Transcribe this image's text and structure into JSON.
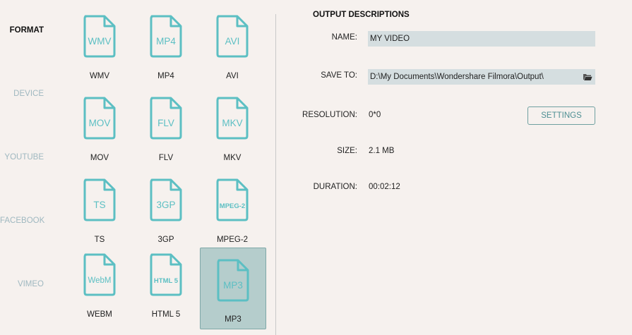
{
  "categories": [
    "FORMAT",
    "DEVICE",
    "YOUTUBE",
    "FACEBOOK",
    "VIMEO"
  ],
  "formats": [
    {
      "icon_text": "WMV",
      "label": "WMV"
    },
    {
      "icon_text": "MP4",
      "label": "MP4"
    },
    {
      "icon_text": "AVI",
      "label": "AVI"
    },
    {
      "icon_text": "MOV",
      "label": "MOV"
    },
    {
      "icon_text": "FLV",
      "label": "FLV"
    },
    {
      "icon_text": "MKV",
      "label": "MKV"
    },
    {
      "icon_text": "TS",
      "label": "TS"
    },
    {
      "icon_text": "3GP",
      "label": "3GP"
    },
    {
      "icon_text": "MPEG-2",
      "label": "MPEG-2"
    },
    {
      "icon_text": "WebM",
      "label": "WEBM"
    },
    {
      "icon_text": "HTML 5",
      "label": "HTML 5"
    },
    {
      "icon_text": "MP3",
      "label": "MP3"
    }
  ],
  "selected_format": "MP3",
  "output": {
    "title": "OUTPUT DESCRIPTIONS",
    "name_label": "NAME:",
    "name_value": "MY VIDEO",
    "save_label": "SAVE TO:",
    "save_path": "D:\\My Documents\\Wondershare Filmora\\Output\\",
    "resolution_label": "RESOLUTION:",
    "resolution_value": "0*0",
    "settings_label": "SETTINGS",
    "size_label": "SIZE:",
    "size_value": "2.1 MB",
    "duration_label": "DURATION:",
    "duration_value": "00:02:12",
    "folder_icon": "folder-open-icon"
  },
  "colors": {
    "background": "#f6f1ee",
    "accent": "#5cbfc3",
    "selected_tile": "#b5cdcc",
    "field_bg": "#d5dee0",
    "inactive_category": "#9fb8c0"
  }
}
